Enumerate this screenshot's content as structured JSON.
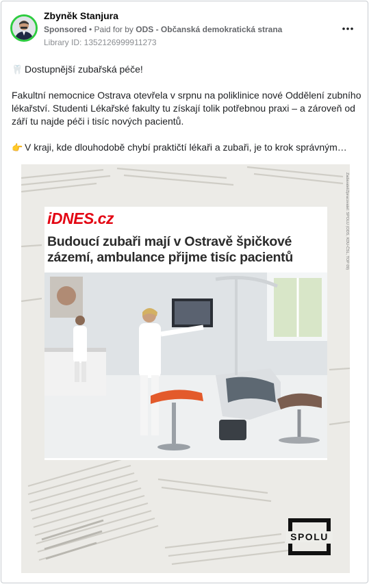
{
  "post": {
    "author": "Zbyněk Stanjura",
    "sponsored_label": "Sponsored",
    "paid_prefix": " • Paid for by ",
    "payer": "ODS - Občanská demokratická strana",
    "library_id": "Library ID: 1352126999911273",
    "more_label": "•••",
    "paragraphs": [
      {
        "icon": "🦷",
        "text": "Dostupnější zubařská péče!"
      },
      {
        "icon": "",
        "text": "Fakultní nemocnice Ostrava otevřela v srpnu na poliklinice nové Oddělení zubního lékařství. Studenti Lékařské fakulty tu získají tolik potřebnou praxi – a zároveň od září tu najde péči i tisíc nových pacientů."
      },
      {
        "icon": "👉",
        "text": "V kraji, kde dlouhodobě chybí praktičtí lékaři a zubaři, je to krok správným…"
      }
    ]
  },
  "creative": {
    "brand": "iDNES.cz",
    "headline": "Budoucí zubaři mají v Ostravě špičkové zázemí, ambulance přijme tisíc pacientů",
    "disclaimer": "Zadavatel/Zpracovatel: SPOLU (ODS, KDU-ČSL, TOP 09)",
    "party_logo": "SPOLU"
  }
}
